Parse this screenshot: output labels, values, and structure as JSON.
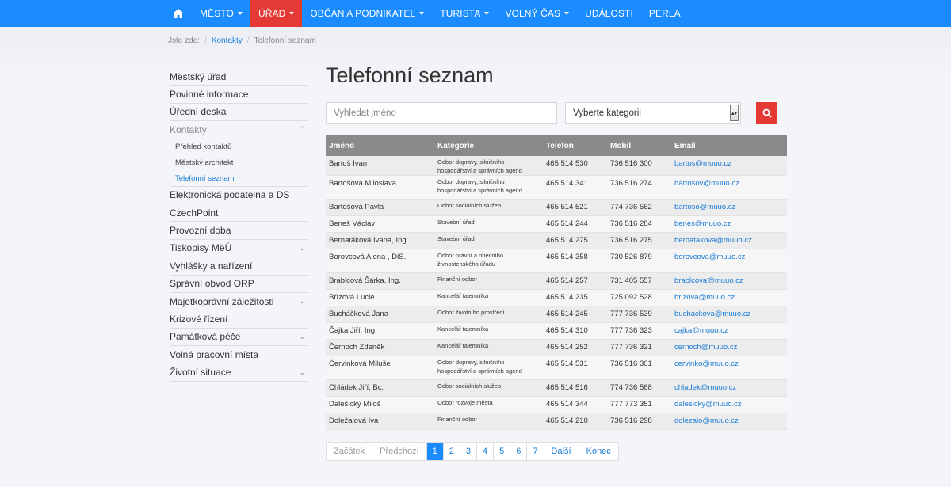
{
  "nav": {
    "home_icon": "home-icon",
    "items": [
      {
        "label": "MĚSTO",
        "dropdown": true,
        "active": false
      },
      {
        "label": "ÚŘAD",
        "dropdown": true,
        "active": true
      },
      {
        "label": "OBČAN A PODNIKATEL",
        "dropdown": true,
        "active": false
      },
      {
        "label": "TURISTA",
        "dropdown": true,
        "active": false
      },
      {
        "label": "VOLNÝ ČAS",
        "dropdown": true,
        "active": false
      },
      {
        "label": "UDÁLOSTI",
        "dropdown": false,
        "active": false
      },
      {
        "label": "PERLA",
        "dropdown": false,
        "active": false
      }
    ],
    "brand_color": "#1a8cff",
    "active_color": "#e53935"
  },
  "breadcrumb": {
    "prefix": "Jste zde:",
    "sep": "/",
    "link": "Kontakty",
    "current": "Telefonní seznam"
  },
  "sidebar": {
    "items": [
      {
        "label": "Městský úřad",
        "chevron": ""
      },
      {
        "label": "Povinné informace",
        "chevron": ""
      },
      {
        "label": "Úřední deska",
        "chevron": ""
      },
      {
        "label": "Kontakty",
        "chevron": "^",
        "expanded": true
      }
    ],
    "subitems": [
      {
        "label": "Přehled kontaktů"
      },
      {
        "label": "Městský architekt"
      },
      {
        "label": "Telefonní seznam"
      }
    ],
    "items_after": [
      {
        "label": "Elektronická podatelna a DS",
        "chevron": ""
      },
      {
        "label": "CzechPoint",
        "chevron": ""
      },
      {
        "label": "Provozní doba",
        "chevron": ""
      },
      {
        "label": "Tiskopisy MěÚ",
        "chevron": "v"
      },
      {
        "label": "Vyhlášky a nařízení",
        "chevron": ""
      },
      {
        "label": "Správní obvod ORP",
        "chevron": ""
      },
      {
        "label": "Majetkoprávní záležitosti",
        "chevron": "v"
      },
      {
        "label": "Krizové řízení",
        "chevron": ""
      },
      {
        "label": "Památková péče",
        "chevron": "v"
      },
      {
        "label": "Volná pracovní místa",
        "chevron": ""
      },
      {
        "label": "Životní situace",
        "chevron": "v"
      }
    ]
  },
  "main": {
    "title": "Telefonní seznam",
    "search_placeholder": "Vyhledat jméno",
    "category_select": "Vyberte kategorii"
  },
  "table": {
    "headers": [
      "Jméno",
      "Kategorie",
      "Telefon",
      "Mobil",
      "Email"
    ],
    "rows": [
      [
        "Bartoš Ivan",
        "Odbor dopravy, silničního hospodářství a správních agend",
        "465 514 530",
        "736 516 300",
        "bartos@muuo.cz"
      ],
      [
        "Bartošová Miloslava",
        "Odbor dopravy, silničního hospodářství a správních agend",
        "465 514 341",
        "736 516 274",
        "bartosov@muuo.cz"
      ],
      [
        "Bartošová Pavla",
        "Odbor sociálních služeb",
        "465 514 521",
        "774 736 562",
        "bartoso@muuo.cz"
      ],
      [
        "Beneš Václav",
        "Stavební úřad",
        "465 514 244",
        "736 516 284",
        "benes@muuo.cz"
      ],
      [
        "Bernatáková Ivana, Ing.",
        "Stavební úřad",
        "465 514 275",
        "736 516 275",
        "bernatakova@muuo.cz"
      ],
      [
        "Borovcová Alena , DiS.",
        "Odbor právní a obecního živnostenského úřadu",
        "465 514 358",
        "730 526 879",
        "borovcova@muuo.cz"
      ],
      [
        "Brablcová Šárka, Ing.",
        "Finanční odbor",
        "465 514 257",
        "731 405 557",
        "brablcova@muuo.cz"
      ],
      [
        "Břízová Lucie",
        "Kancelář tajemníka",
        "465 514 235",
        "725 092 528",
        "brizova@muuo.cz"
      ],
      [
        "Bucháčková Jana",
        "Odbor životního prostředí",
        "465 514 245",
        "777 736 539",
        "buchackova@muuo.cz"
      ],
      [
        "Čajka Jiří, Ing.",
        "Kancelář tajemníka",
        "465 514 310",
        "777 736 323",
        "cajka@muuo.cz"
      ],
      [
        "Černoch Zdeněk",
        "Kancelář tajemníka",
        "465 514 252",
        "777 736 321",
        "cernoch@muuo.cz"
      ],
      [
        "Červinková Miluše",
        "Odbor dopravy, silničního hospodářství a správních agend",
        "465 514 531",
        "736 516 301",
        "cervinko@muuo.cz"
      ],
      [
        "Chládek Jiří, Bc.",
        "Odbor sociálních služeb",
        "465 514 516",
        "774 736 568",
        "chladek@muuo.cz"
      ],
      [
        "Dalešický Miloš",
        "Odbor rozvoje města",
        "465 514 344",
        "777 773 351",
        "dalesicky@muuo.cz"
      ],
      [
        "Doležalová Iva",
        "Finanční odbor",
        "465 514 210",
        "736 516 298",
        "dolezalo@muuo.cz"
      ]
    ]
  },
  "pagination": {
    "first": "Začátek",
    "prev": "Předchozí",
    "pages": [
      "1",
      "2",
      "3",
      "4",
      "5",
      "6",
      "7"
    ],
    "current": "1",
    "next": "Další",
    "last": "Konec"
  }
}
